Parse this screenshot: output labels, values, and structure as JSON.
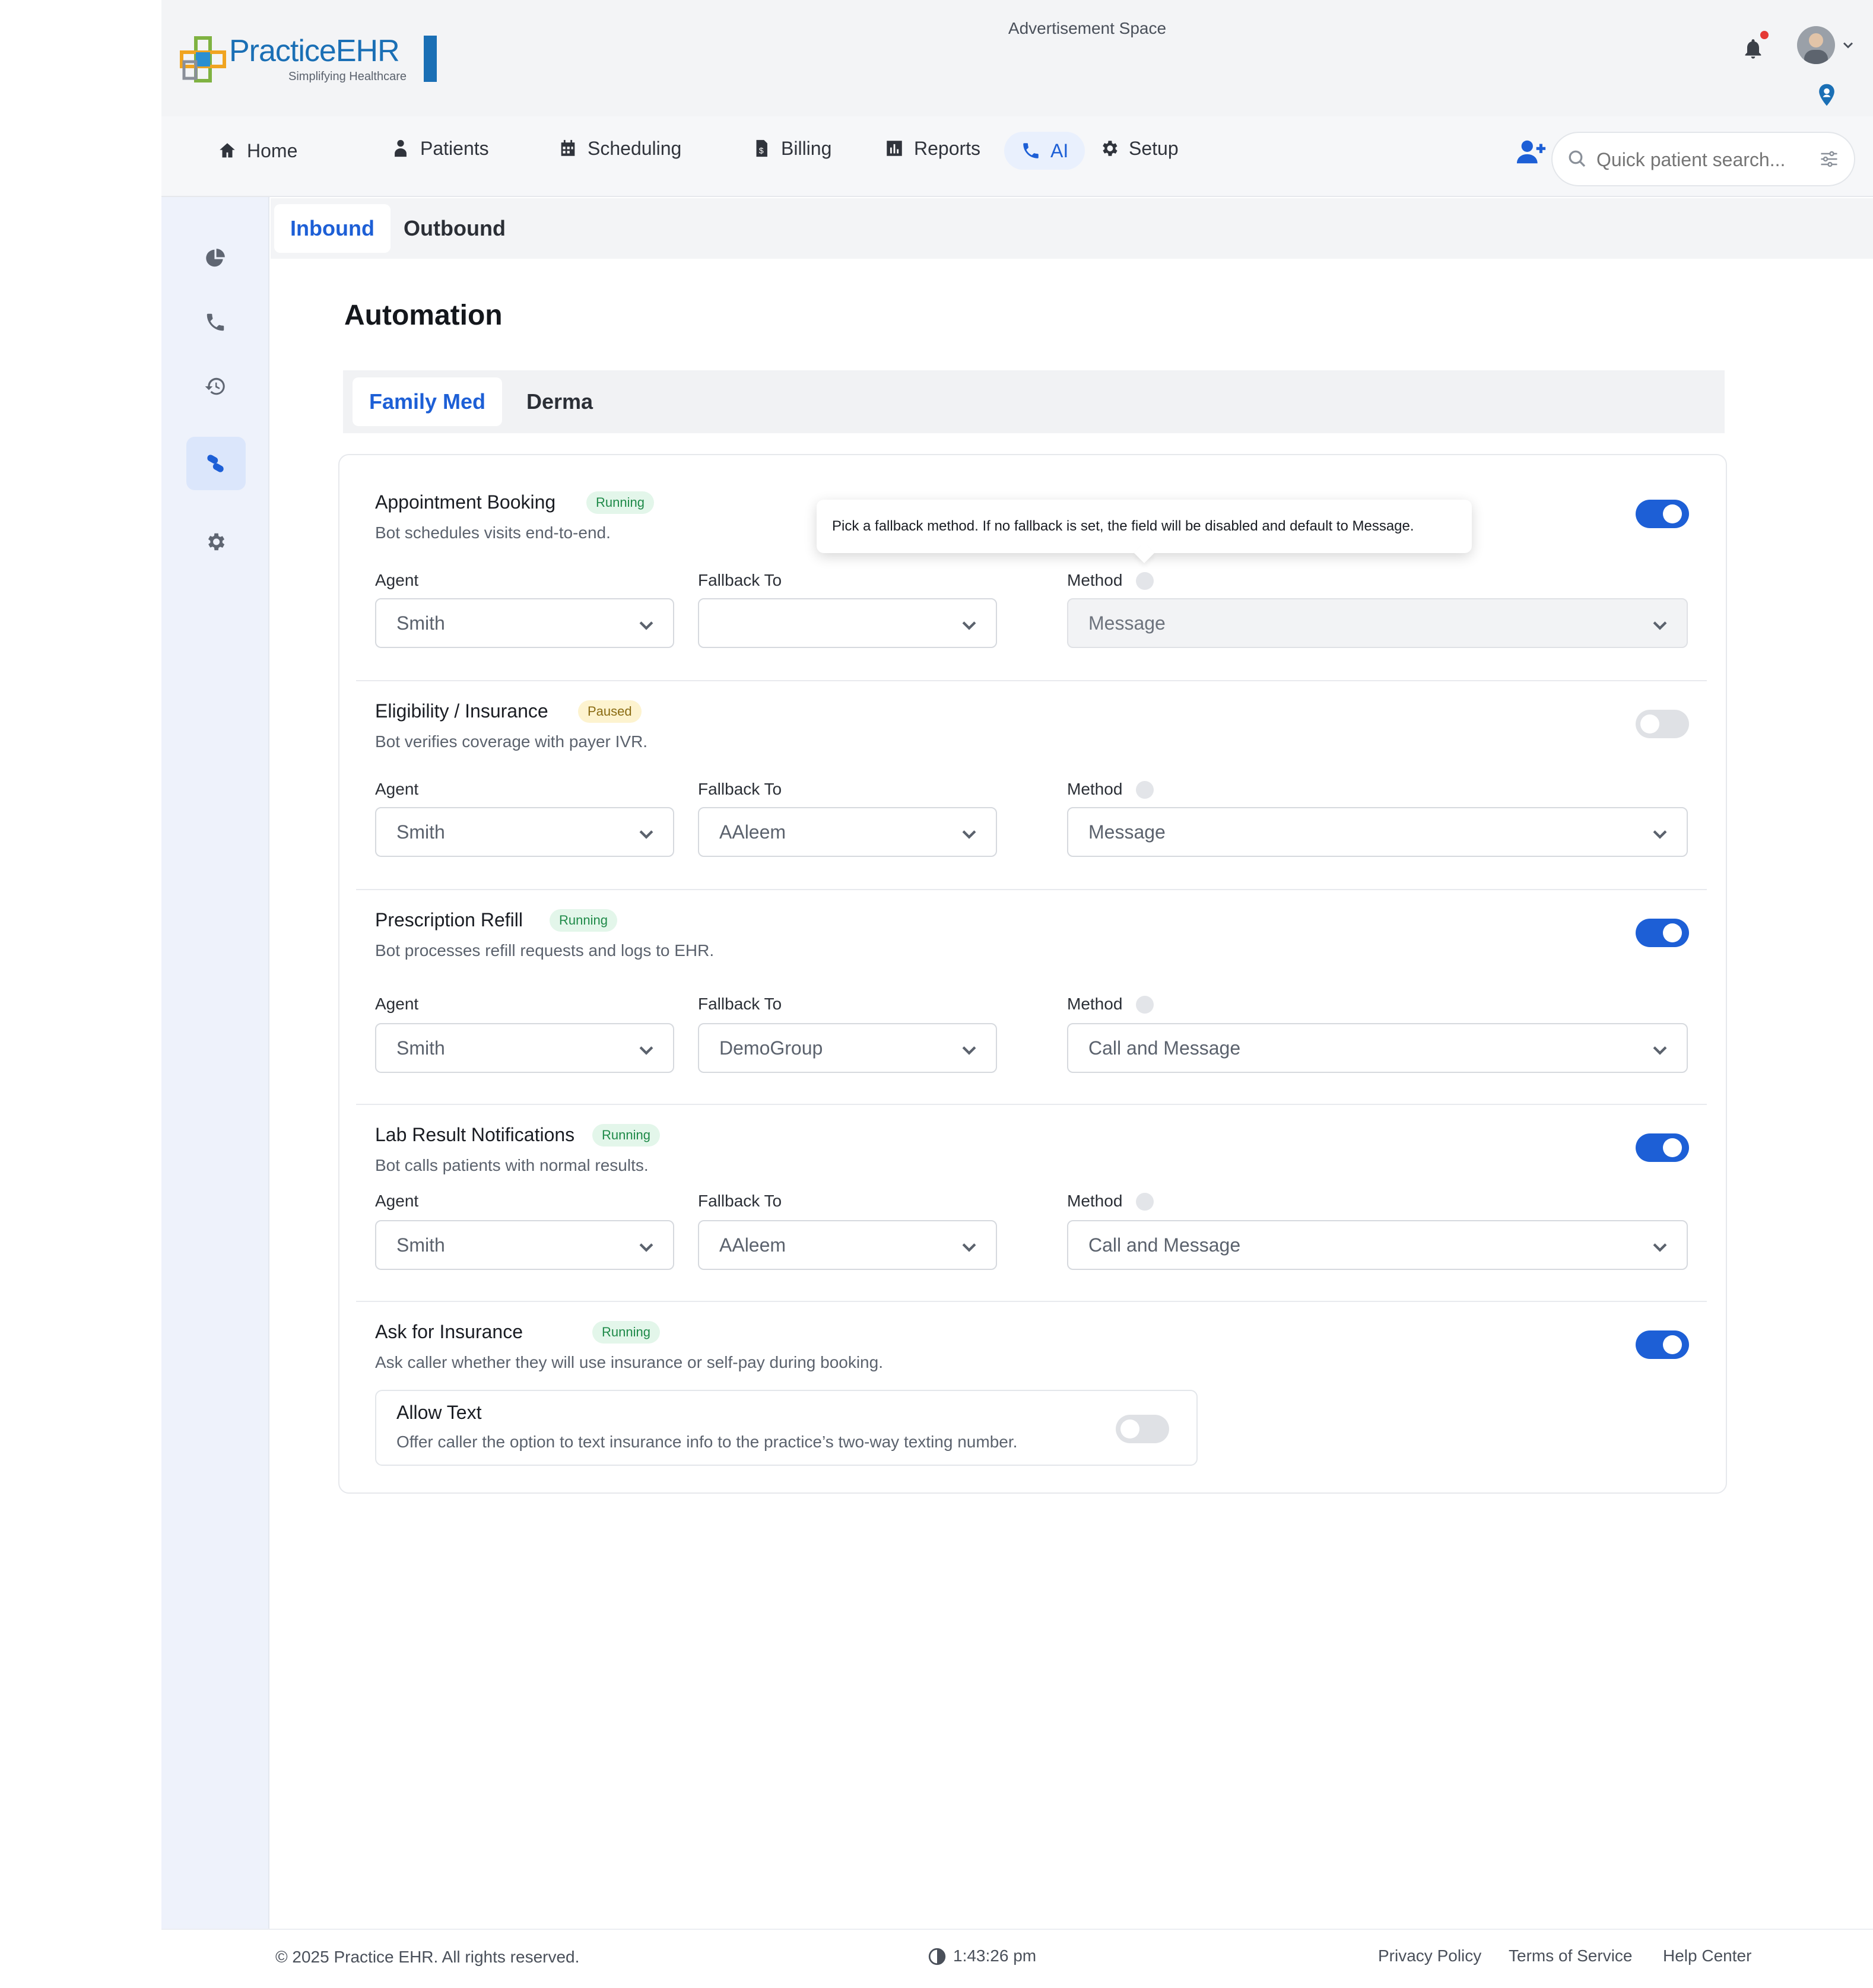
{
  "header": {
    "logo_text": "PracticeEHR",
    "logo_tagline": "Simplifying Healthcare",
    "ad_space": "Advertisement Space"
  },
  "nav": {
    "items": [
      {
        "label": "Home",
        "icon": "home-icon"
      },
      {
        "label": "Patients",
        "icon": "patient-icon"
      },
      {
        "label": "Scheduling",
        "icon": "calendar-icon"
      },
      {
        "label": "Billing",
        "icon": "billing-icon"
      },
      {
        "label": "Reports",
        "icon": "chart-icon"
      },
      {
        "label": "AI",
        "icon": "phone-icon"
      },
      {
        "label": "Setup",
        "icon": "gear-icon"
      }
    ],
    "search_placeholder": "Quick patient search..."
  },
  "sidebar": {
    "icons": [
      "pie-chart-icon",
      "phone-icon",
      "history-icon",
      "automation-icon",
      "settings-icon"
    ]
  },
  "tabs": {
    "inbound": "Inbound",
    "outbound": "Outbound"
  },
  "page": {
    "title": "Automation",
    "subtabs": [
      "Family Med",
      "Derma"
    ]
  },
  "tooltip": "Pick a fallback method. If no fallback is set, the field will be disabled and default to Message.",
  "labels": {
    "agent": "Agent",
    "fallback": "Fallback To",
    "method": "Method"
  },
  "automations": [
    {
      "title": "Appointment Booking",
      "status": "Running",
      "desc": "Bot schedules visits end-to-end.",
      "agent": "Smith",
      "fallback": "",
      "method": "Message",
      "enabled": true
    },
    {
      "title": "Eligibility / Insurance",
      "status": "Paused",
      "desc": "Bot verifies coverage with payer IVR.",
      "agent": "Smith",
      "fallback": "AAleem",
      "method": "Message",
      "enabled": false
    },
    {
      "title": "Prescription Refill",
      "status": "Running",
      "desc": "Bot processes refill requests and logs to EHR.",
      "agent": "Smith",
      "fallback": "DemoGroup",
      "method": "Call and Message",
      "enabled": true
    },
    {
      "title": "Lab Result Notifications",
      "status": "Running",
      "desc": "Bot calls patients with normal results.",
      "agent": "Smith",
      "fallback": "AAleem",
      "method": "Call and Message",
      "enabled": true
    },
    {
      "title": "Ask for Insurance",
      "status": "Running",
      "desc": "Ask caller whether they will use insurance or self-pay during booking.",
      "enabled": true
    }
  ],
  "allow_text": {
    "title": "Allow Text",
    "desc": "Offer caller the option to text insurance info to the practice’s two-way texting number.",
    "enabled": false
  },
  "footer": {
    "copyright": "© 2025 Practice EHR. All rights reserved.",
    "time": "1:43:26 pm",
    "links": [
      "Privacy Policy",
      "Terms of Service",
      "Help Center"
    ]
  },
  "colors": {
    "accent": "#1d5fd6",
    "running_bg": "#e3f6ea",
    "paused_bg": "#fdf3cf",
    "notification_dot": "#e53935"
  }
}
